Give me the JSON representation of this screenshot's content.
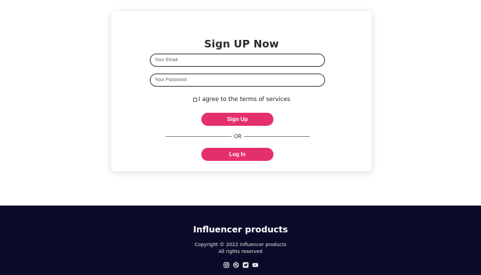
{
  "signup_card": {
    "title": "Sign UP Now",
    "email_placeholder": "Your Email",
    "password_placeholder": "Your Password",
    "agree_label": "I agree to the terms of services",
    "signup_label": "Sign Up",
    "or_label": "OR",
    "login_label": "Log In"
  },
  "footer": {
    "title": "Influencer products",
    "copyright": "Copyright © 2022 Influencer products",
    "rights": "All rights reserved",
    "social_icons": [
      "instagram-icon",
      "dribbble-icon",
      "twitter-icon",
      "youtube-icon"
    ]
  },
  "colors": {
    "accent": "#e42f6e",
    "footer_bg": "#0b0a28",
    "page_bg": "#ffffff"
  }
}
